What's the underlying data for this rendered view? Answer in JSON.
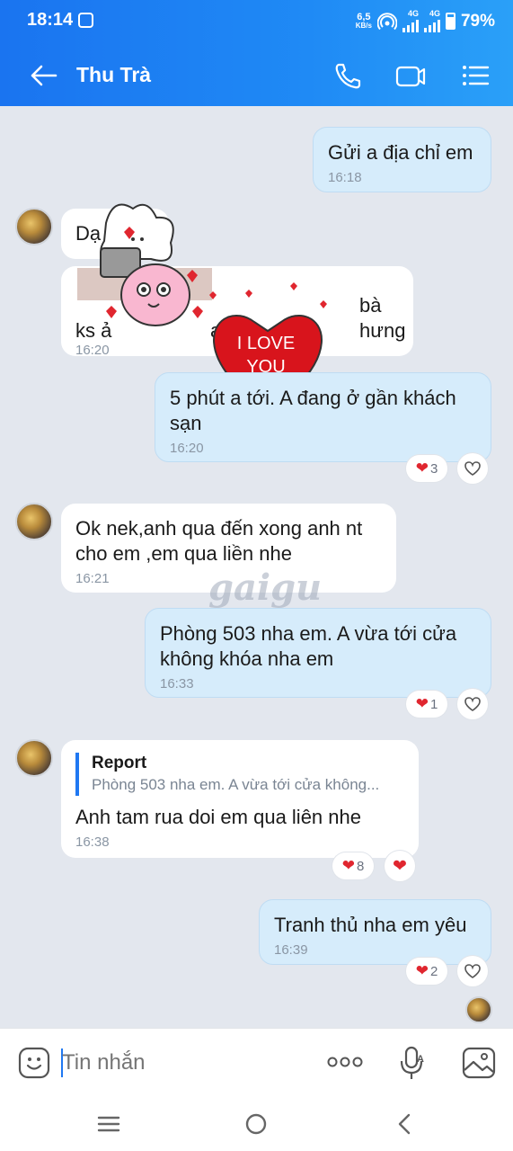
{
  "status_bar": {
    "time": "18:14",
    "net_speed": "6,5",
    "net_unit": "KB/s",
    "net_type_1": "4G",
    "net_type_2": "4G",
    "battery": "79%"
  },
  "header": {
    "contact_name": "Thu Trà",
    "back_icon": "arrow-left-icon",
    "call_icon": "phone-icon",
    "video_icon": "video-camera-icon",
    "menu_icon": "list-menu-icon"
  },
  "messages": [
    {
      "side": "out",
      "text": "Gửi a địa chỉ em",
      "time": "16:18"
    },
    {
      "side": "in",
      "text": "Dạ"
    },
    {
      "side": "in",
      "text_parts": [
        "bà hưng",
        "ks ả",
        "ạ"
      ],
      "time": "16:20"
    },
    {
      "side": "out",
      "text": "5 phút a tới. A đang ở gần khách sạn",
      "time": "16:20",
      "reaction_count": "3"
    },
    {
      "side": "in",
      "text": "Ok nek,anh qua đến xong anh nt cho em ,em qua liền nhe",
      "time": "16:21"
    },
    {
      "side": "out",
      "text": "Phòng 503 nha em. A vừa tới cửa không khóa nha em",
      "time": "16:33",
      "reaction_count": "1"
    },
    {
      "side": "in",
      "reply_name": "Report",
      "reply_text": "Phòng 503 nha em. A vừa tới cửa không...",
      "text": "Anh tam rua doi em qua liên nhe",
      "time": "16:38",
      "reaction_count": "8"
    },
    {
      "side": "out",
      "text": "Tranh thủ nha em yêu",
      "time": "16:39",
      "reaction_count": "2"
    }
  ],
  "sticker": {
    "text_line1": "I LOVE",
    "text_line2": "YOU"
  },
  "watermark": "gaigu",
  "input": {
    "placeholder": "Tin nhắn",
    "emoji_icon": "emoji-icon",
    "more_icon": "more-dots-icon",
    "mic_icon": "voice-mic-icon",
    "image_icon": "image-gallery-icon"
  },
  "colors": {
    "header": "#1f84f4",
    "outgoing_bubble": "#d6ecfb",
    "incoming_bubble": "#ffffff",
    "chat_bg": "#e3e7ee",
    "heart": "#e0262f"
  }
}
